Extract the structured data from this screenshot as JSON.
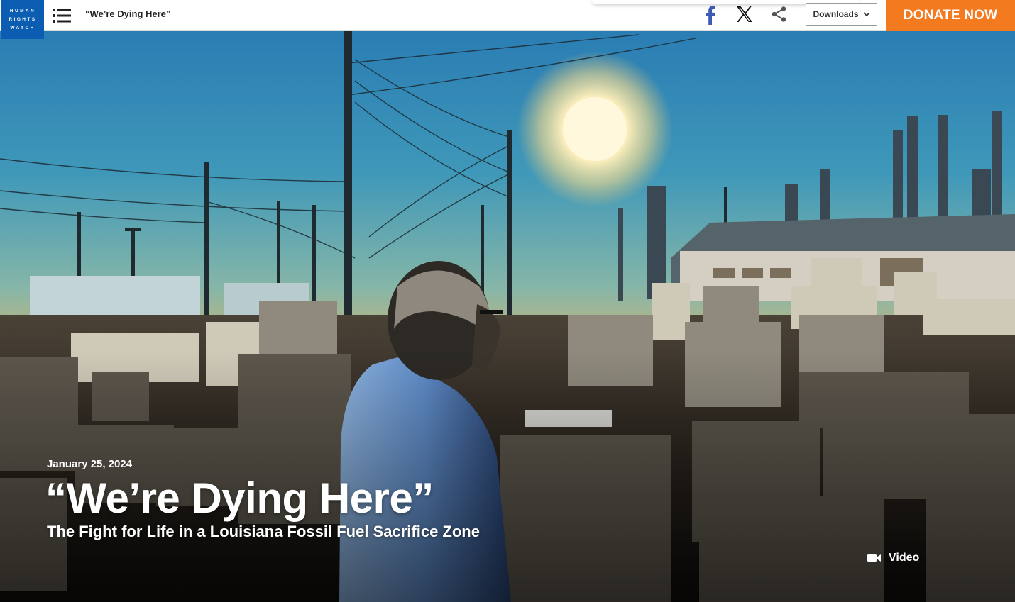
{
  "header": {
    "logo_lines": [
      "HUMAN",
      "RIGHTS",
      "WATCH"
    ],
    "crumb": "“We’re Dying Here”",
    "downloads_label": "Downloads",
    "donate_label": "DONATE NOW"
  },
  "icons": {
    "menu": "list-icon",
    "facebook": "facebook-icon",
    "x": "x-icon",
    "share": "share-icon",
    "chevron": "chevron-down-icon",
    "video": "video-camera-icon"
  },
  "colors": {
    "brand_blue": "#0a5db0",
    "donate_orange": "#f47a20"
  },
  "hero": {
    "date": "January 25, 2024",
    "title": "“We’re Dying Here”",
    "subtitle": "The Fight for Life in a Louisiana Fossil Fuel Sacrifice Zone",
    "video_label": "Video"
  }
}
